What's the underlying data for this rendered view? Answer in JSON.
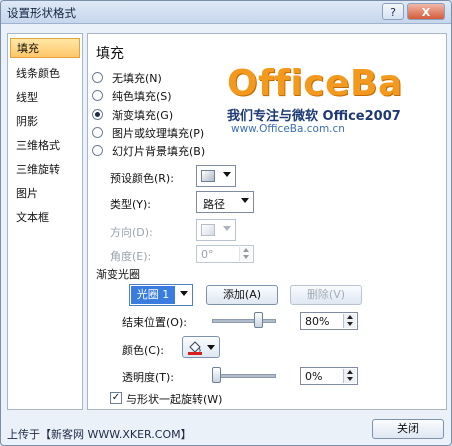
{
  "window": {
    "title": "设置形状格式",
    "help_label": "?",
    "close_label": "X"
  },
  "sidebar": {
    "items": [
      {
        "label": "填充",
        "active": true
      },
      {
        "label": "线条颜色"
      },
      {
        "label": "线型"
      },
      {
        "label": "阴影"
      },
      {
        "label": "三维格式"
      },
      {
        "label": "三维旋转"
      },
      {
        "label": "图片"
      },
      {
        "label": "文本框"
      }
    ]
  },
  "panel": {
    "title": "填充",
    "radios": [
      {
        "label": "无填充(N)",
        "checked": false
      },
      {
        "label": "纯色填充(S)",
        "checked": false
      },
      {
        "label": "渐变填充(G)",
        "checked": true
      },
      {
        "label": "图片或纹理填充(P)",
        "checked": false
      },
      {
        "label": "幻灯片背景填充(B)",
        "checked": false
      }
    ],
    "preset_label": "预设颜色(R):",
    "type_label": "类型(Y):",
    "type_value": "路径",
    "direction_label": "方向(D):",
    "angle_label": "角度(E):",
    "angle_value": "0°",
    "stops_label": "渐变光圈",
    "stop_value": "光圈 1",
    "add_label": "添加(A)",
    "delete_label": "删除(V)",
    "end_pos_label": "结束位置(O):",
    "end_pos_value": "80%",
    "end_pos_fraction": 0.8,
    "color_label": "颜色(C):",
    "transparency_label": "透明度(T):",
    "transparency_value": "0%",
    "transparency_fraction": 0,
    "rotate_label": "与形状一起旋转(W)",
    "rotate_checked": true,
    "check_mark": "✓"
  },
  "logo": {
    "main": "OfficeBa",
    "sub": "我们专注与微软 Office2007",
    "url": "www.OfficeBa.com.cn"
  },
  "footer": {
    "text": "上传于【新客网 WWW.XKER.COM】",
    "close_label": "关闭"
  },
  "colors": {
    "accent": "#f39a1e",
    "active_item": "#ffc56a",
    "selected_stop": "#3a7de0",
    "fill_color": "#d71f1f"
  }
}
